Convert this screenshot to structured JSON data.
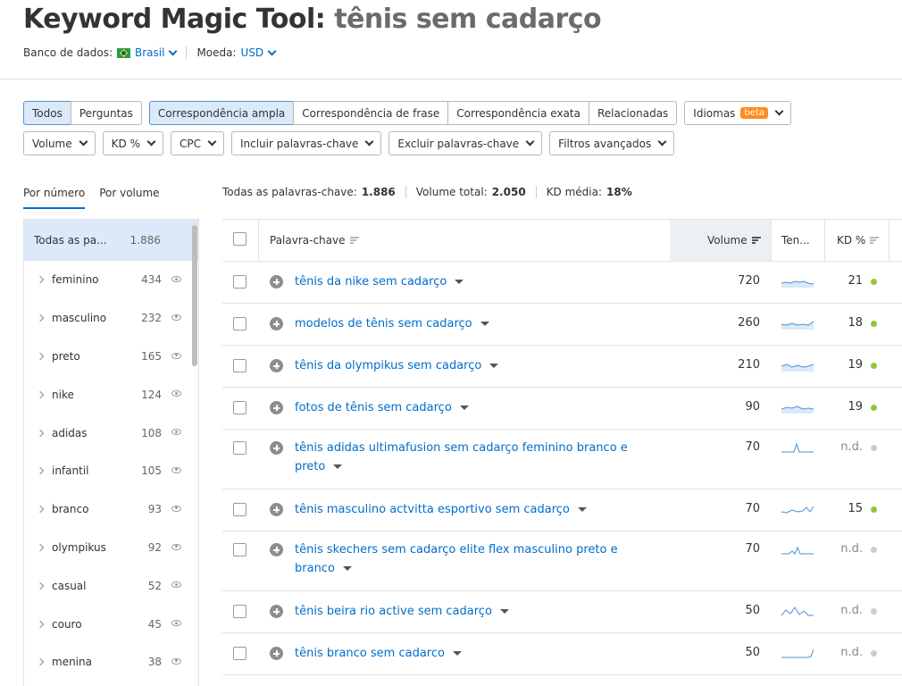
{
  "title": {
    "tool": "Keyword Magic Tool:",
    "query": "tênis sem cadarço"
  },
  "database": {
    "label": "Banco de dados:",
    "country": "Brasil",
    "currency_label": "Moeda:",
    "currency": "USD"
  },
  "match_buttons": {
    "all": "Todos",
    "questions": "Perguntas",
    "broad": "Correspondência ampla",
    "phrase": "Correspondência de frase",
    "exact": "Correspondência exata",
    "related": "Relacionadas",
    "languages": "Idiomas",
    "beta": "beta"
  },
  "filters": {
    "volume": "Volume",
    "kd": "KD %",
    "cpc": "CPC",
    "include": "Incluir palavras-chave",
    "exclude": "Excluir palavras-chave",
    "advanced": "Filtros avançados"
  },
  "side_tabs": {
    "by_number": "Por número",
    "by_volume": "Por volume"
  },
  "summary": {
    "all_keywords_label": "Todas as palavras-chave:",
    "all_keywords_value": "1.886",
    "total_volume_label": "Volume total:",
    "total_volume_value": "2.050",
    "avg_kd_label": "KD média:",
    "avg_kd_value": "18%"
  },
  "sidebar": [
    {
      "label": "Todas as pa...",
      "count": "1.886"
    },
    {
      "label": "feminino",
      "count": "434"
    },
    {
      "label": "masculino",
      "count": "232"
    },
    {
      "label": "preto",
      "count": "165"
    },
    {
      "label": "nike",
      "count": "124"
    },
    {
      "label": "adidas",
      "count": "108"
    },
    {
      "label": "infantil",
      "count": "105"
    },
    {
      "label": "branco",
      "count": "93"
    },
    {
      "label": "olympikus",
      "count": "92"
    },
    {
      "label": "casual",
      "count": "52"
    },
    {
      "label": "couro",
      "count": "45"
    },
    {
      "label": "menina",
      "count": "38"
    }
  ],
  "table": {
    "headers": {
      "keyword": "Palavra-chave",
      "volume": "Volume",
      "trend": "Ten...",
      "kd": "KD %"
    },
    "rows": [
      {
        "keyword": "tênis da nike sem cadarço",
        "volume": "720",
        "kd": "21"
      },
      {
        "keyword": "modelos de tênis sem cadarço",
        "volume": "260",
        "kd": "18"
      },
      {
        "keyword": "tênis da olympikus sem cadarço",
        "volume": "210",
        "kd": "19"
      },
      {
        "keyword": "fotos de tênis sem cadarço",
        "volume": "90",
        "kd": "19"
      },
      {
        "keyword": "tênis adidas ultimafusion sem cadarço feminino branco e preto",
        "volume": "70",
        "kd": "n.d."
      },
      {
        "keyword": "tênis masculino actvitta esportivo sem cadarço",
        "volume": "70",
        "kd": "15"
      },
      {
        "keyword": "tênis skechers sem cadarço elite flex masculino preto e branco",
        "volume": "70",
        "kd": "n.d."
      },
      {
        "keyword": "tênis beira rio active sem cadarço",
        "volume": "50",
        "kd": "n.d."
      },
      {
        "keyword": "tênis branco sem cadarco",
        "volume": "50",
        "kd": "n.d."
      }
    ]
  },
  "colors": {
    "link": "#006dca",
    "active_bg": "#dbe9f8",
    "kd_easy": "#8dc63f",
    "kd_none": "#cccccc",
    "beta": "#ff8c1a"
  }
}
